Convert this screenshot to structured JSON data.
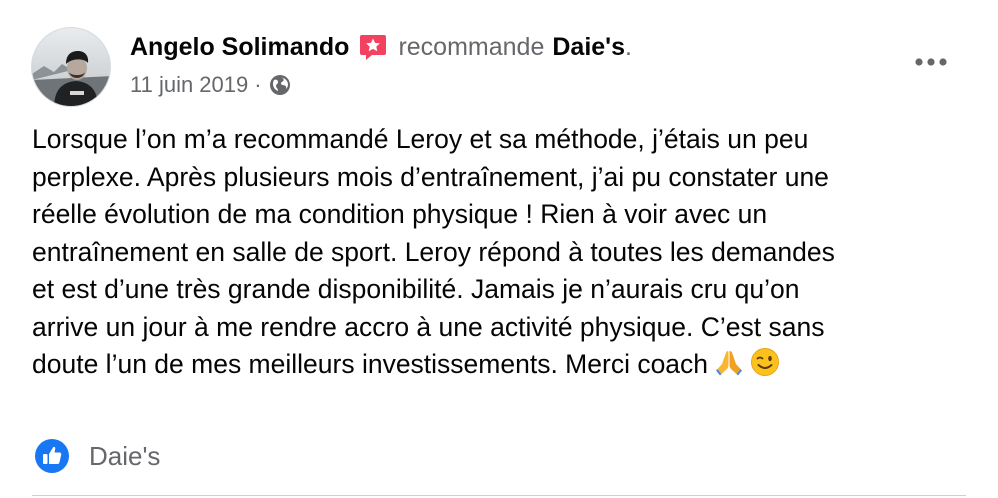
{
  "post": {
    "author_name": "Angelo Solimando",
    "recommends_text": "recommande",
    "page_name": "Daie's",
    "page_name_suffix": ".",
    "date": "11 juin 2019",
    "meta_separator": "·",
    "privacy_icon": "globe-icon",
    "recommendation_icon": "recommendation-badge-icon",
    "body_lines": [
      "Lorsque l’on m’a recommandé Leroy et sa méthode, j’étais un peu",
      "perplexe. Après plusieurs mois d’entraînement, j’ai pu constater une",
      "réelle évolution de ma condition physique ! Rien à voir avec un",
      "entraînement en salle de sport. Leroy répond à toutes les demandes",
      "et est d’une très grande disponibilité. Jamais je n’aurais cru qu’on",
      "arrive un jour à me rendre accro à une activité physique. C’est sans",
      "doute l’un de mes meilleurs investissements. Merci coach"
    ],
    "emojis": [
      "folded-hands",
      "winking-face"
    ]
  },
  "reactions": {
    "icon": "like-thumb-icon",
    "name": "Daie's"
  },
  "colors": {
    "primary_text": "#050505",
    "secondary_text": "#65676b",
    "like_blue": "#1877f2",
    "recommend_red": "#f3425f",
    "divider": "#ced0d4"
  }
}
